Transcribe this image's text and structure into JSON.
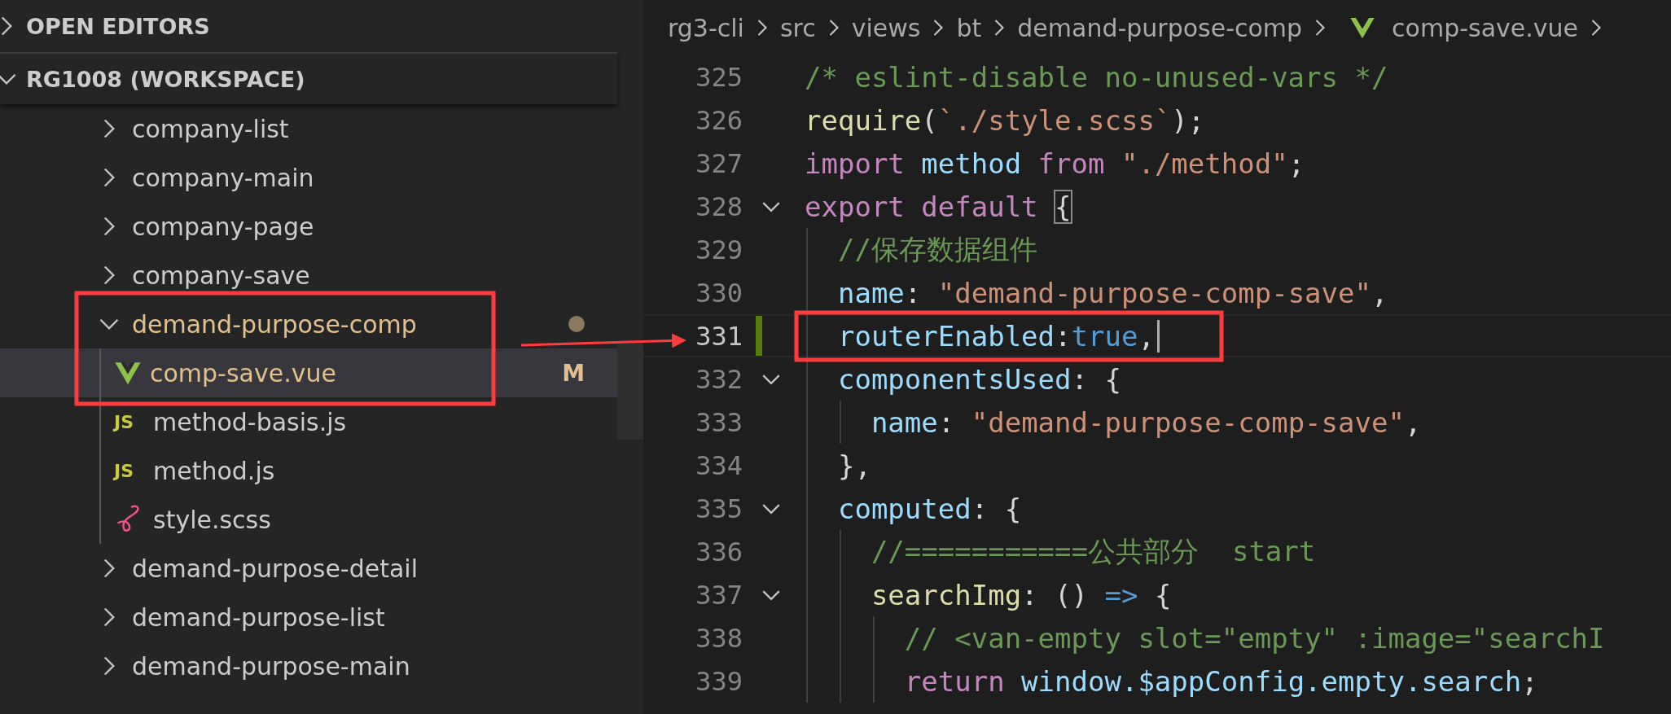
{
  "sidebar": {
    "sections": [
      {
        "title": "OPEN EDITORS",
        "expanded": false
      },
      {
        "title": "RG1008 (WORKSPACE)",
        "expanded": true
      }
    ],
    "tree": [
      {
        "name": "company-list",
        "kind": "folder",
        "expanded": false,
        "selected": false,
        "modified": false
      },
      {
        "name": "company-main",
        "kind": "folder",
        "expanded": false,
        "selected": false,
        "modified": false
      },
      {
        "name": "company-page",
        "kind": "folder",
        "expanded": false,
        "selected": false,
        "modified": false
      },
      {
        "name": "company-save",
        "kind": "folder",
        "expanded": false,
        "selected": false,
        "modified": false
      },
      {
        "name": "demand-purpose-comp",
        "kind": "folder",
        "expanded": true,
        "selected": false,
        "modified": true,
        "children": [
          {
            "name": "comp-save.vue",
            "kind": "vue",
            "selected": true,
            "modified": true,
            "badge": "M"
          },
          {
            "name": "method-basis.js",
            "kind": "js",
            "icon_label": "JS",
            "selected": false,
            "modified": false
          },
          {
            "name": "method.js",
            "kind": "js",
            "icon_label": "JS",
            "selected": false,
            "modified": false
          },
          {
            "name": "style.scss",
            "kind": "scss",
            "selected": false,
            "modified": false
          }
        ]
      },
      {
        "name": "demand-purpose-detail",
        "kind": "folder",
        "expanded": false,
        "selected": false,
        "modified": false
      },
      {
        "name": "demand-purpose-list",
        "kind": "folder",
        "expanded": false,
        "selected": false,
        "modified": false
      },
      {
        "name": "demand-purpose-main",
        "kind": "folder",
        "expanded": false,
        "selected": false,
        "modified": false
      }
    ]
  },
  "editor": {
    "breadcrumb": [
      {
        "label": "rg3-cli",
        "kind": "folder"
      },
      {
        "label": "src",
        "kind": "folder"
      },
      {
        "label": "views",
        "kind": "folder"
      },
      {
        "label": "bt",
        "kind": "folder"
      },
      {
        "label": "demand-purpose-comp",
        "kind": "folder"
      },
      {
        "label": "comp-save.vue",
        "kind": "vue"
      }
    ],
    "lines": [
      {
        "number": "325",
        "foldable": false,
        "active": false,
        "modified": false,
        "tokens": [
          {
            "kind": "comment",
            "text": "/* eslint-disable no-unused-vars */"
          }
        ]
      },
      {
        "number": "326",
        "foldable": false,
        "active": false,
        "modified": false,
        "tokens": [
          {
            "kind": "function",
            "text": "require"
          },
          {
            "kind": "punct",
            "text": "("
          },
          {
            "kind": "string",
            "text": "`./style.scss`"
          },
          {
            "kind": "punct",
            "text": ");"
          }
        ]
      },
      {
        "number": "327",
        "foldable": false,
        "active": false,
        "modified": false,
        "tokens": [
          {
            "kind": "keyword",
            "text": "import "
          },
          {
            "kind": "variable",
            "text": "method "
          },
          {
            "kind": "keyword",
            "text": "from "
          },
          {
            "kind": "string",
            "text": "\"./method\""
          },
          {
            "kind": "punct",
            "text": ";"
          }
        ]
      },
      {
        "number": "328",
        "foldable": true,
        "active": false,
        "modified": false,
        "tokens": [
          {
            "kind": "keyword",
            "text": "export default "
          },
          {
            "kind": "bracket-match",
            "text": "{"
          }
        ]
      },
      {
        "number": "329",
        "foldable": false,
        "active": false,
        "modified": false,
        "tokens": [
          {
            "kind": "comment",
            "text": "  //保存数据组件"
          }
        ]
      },
      {
        "number": "330",
        "foldable": false,
        "active": false,
        "modified": false,
        "tokens": [
          {
            "kind": "variable",
            "text": "  name"
          },
          {
            "kind": "punct",
            "text": ": "
          },
          {
            "kind": "string",
            "text": "\"demand-purpose-comp-save\""
          },
          {
            "kind": "punct",
            "text": ","
          }
        ]
      },
      {
        "number": "331",
        "foldable": false,
        "active": true,
        "modified": true,
        "tokens": [
          {
            "kind": "variable",
            "text": "  routerEnabled"
          },
          {
            "kind": "punct",
            "text": ":"
          },
          {
            "kind": "constant",
            "text": "true"
          },
          {
            "kind": "punct",
            "text": ","
          }
        ]
      },
      {
        "number": "332",
        "foldable": true,
        "active": false,
        "modified": false,
        "tokens": [
          {
            "kind": "variable",
            "text": "  componentsUsed"
          },
          {
            "kind": "punct",
            "text": ": {"
          }
        ]
      },
      {
        "number": "333",
        "foldable": false,
        "active": false,
        "modified": false,
        "tokens": [
          {
            "kind": "variable",
            "text": "    name"
          },
          {
            "kind": "punct",
            "text": ": "
          },
          {
            "kind": "string",
            "text": "\"demand-purpose-comp-save\""
          },
          {
            "kind": "punct",
            "text": ","
          }
        ]
      },
      {
        "number": "334",
        "foldable": false,
        "active": false,
        "modified": false,
        "tokens": [
          {
            "kind": "punct",
            "text": "  },"
          }
        ]
      },
      {
        "number": "335",
        "foldable": true,
        "active": false,
        "modified": false,
        "tokens": [
          {
            "kind": "variable",
            "text": "  computed"
          },
          {
            "kind": "punct",
            "text": ": {"
          }
        ]
      },
      {
        "number": "336",
        "foldable": false,
        "active": false,
        "modified": false,
        "tokens": [
          {
            "kind": "comment",
            "text": "    //===========公共部分  start"
          }
        ]
      },
      {
        "number": "337",
        "foldable": true,
        "active": false,
        "modified": false,
        "tokens": [
          {
            "kind": "function",
            "text": "    searchImg"
          },
          {
            "kind": "punct",
            "text": ": () "
          },
          {
            "kind": "constant",
            "text": "=>"
          },
          {
            "kind": "punct",
            "text": " {"
          }
        ]
      },
      {
        "number": "338",
        "foldable": false,
        "active": false,
        "modified": false,
        "tokens": [
          {
            "kind": "comment",
            "text": "      // <van-empty slot=\"empty\" :image=\"searchI"
          }
        ]
      },
      {
        "number": "339",
        "foldable": false,
        "active": false,
        "modified": false,
        "tokens": [
          {
            "kind": "keyword",
            "text": "      return "
          },
          {
            "kind": "variable",
            "text": "window.$appConfig.empty.search"
          },
          {
            "kind": "punct",
            "text": ";"
          }
        ]
      }
    ]
  }
}
